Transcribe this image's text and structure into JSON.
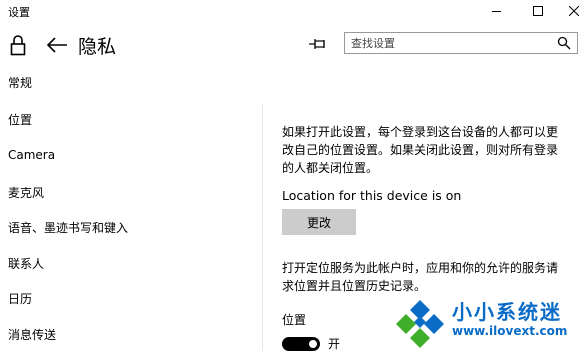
{
  "window": {
    "title": "设置"
  },
  "header": {
    "title": "隐私",
    "search_placeholder": "查找设置"
  },
  "sidebar": {
    "items": [
      {
        "label": "常规"
      },
      {
        "label": "位置"
      },
      {
        "label": "Camera"
      },
      {
        "label": "麦克风"
      },
      {
        "label": "语音、墨迹书写和键入"
      },
      {
        "label": "联系人"
      },
      {
        "label": "日历"
      },
      {
        "label": "消息传送"
      }
    ]
  },
  "main": {
    "intro_line1": "如果打开此设置，每个登录到这台设备的人都可以更",
    "intro_line2": "改自己的位置设置。如果关闭此设置，则对所有登录",
    "intro_line3": "的人都关闭位置。",
    "device_status": "Location for this device is on",
    "change_button": "更改",
    "service_line1": "打开定位服务为此帐户时，应用和你的允许的服务请",
    "service_line2": "求位置并且位置历史记录。",
    "location_label": "位置",
    "toggle_state": "开",
    "toggle_on": true
  },
  "watermark": {
    "name": "小小系统迷",
    "url": "www.ilovext.com"
  },
  "colors": {
    "watermark_blue": "#0a6cc7",
    "watermark_green": "#3fae2a",
    "button_gray": "#cccccc"
  }
}
